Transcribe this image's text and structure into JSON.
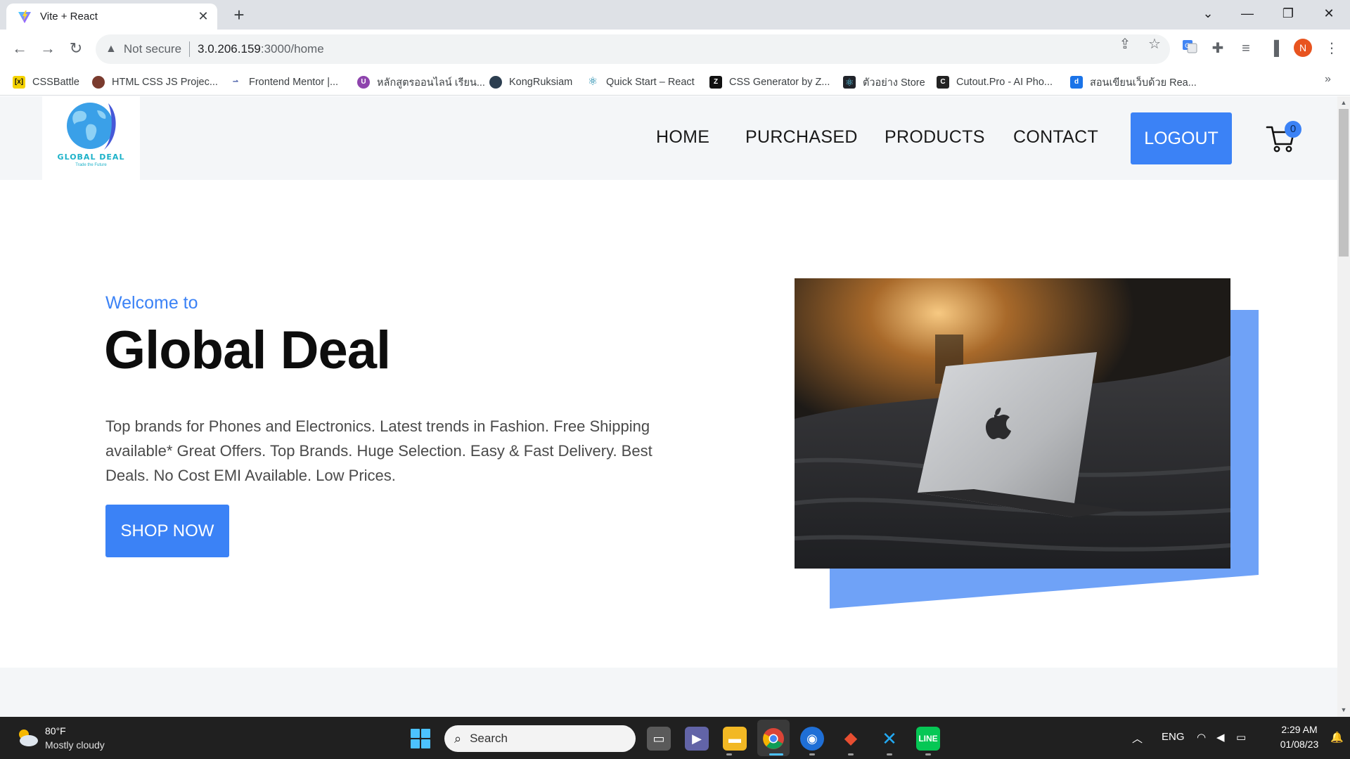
{
  "browser": {
    "tab_title": "Vite + React",
    "security_label": "Not secure",
    "url_host": "3.0.206.159",
    "url_path": ":3000/home",
    "profile_initial": "N"
  },
  "bookmarks": [
    {
      "label": "CSSBattle",
      "icon": "cssbattle-icon",
      "color": "#f5d300"
    },
    {
      "label": "HTML CSS JS Projec...",
      "icon": "avatar-icon",
      "color": "#7a3b2e"
    },
    {
      "label": "Frontend Mentor |...",
      "icon": "frontendmentor-icon",
      "color": "#3e54a3"
    },
    {
      "label": "หลักสูตรออนไลน์ เรียน...",
      "icon": "course-icon",
      "color": "#8e44ad"
    },
    {
      "label": "KongRuksiam",
      "icon": "kong-icon",
      "color": "#2c3e50"
    },
    {
      "label": "Quick Start – React",
      "icon": "react-icon",
      "color": "#087ea4"
    },
    {
      "label": "CSS Generator by Z...",
      "icon": "z-icon",
      "color": "#111111"
    },
    {
      "label": "ตัวอย่าง Store",
      "icon": "react-dark-icon",
      "color": "#20232a"
    },
    {
      "label": "Cutout.Pro - AI Pho...",
      "icon": "cutout-icon",
      "color": "#222222"
    },
    {
      "label": "สอนเขียนเว็บด้วย Rea...",
      "icon": "blog-icon",
      "color": "#1a73e8"
    }
  ],
  "site": {
    "logo_name": "GLOBAL DEAL",
    "logo_tagline": "Trade the Future",
    "nav": [
      "HOME",
      "PURCHASED",
      "PRODUCTS",
      "CONTACT"
    ],
    "logout_label": "LOGOUT",
    "cart_count": "0",
    "accent_color": "#3b82f6"
  },
  "hero": {
    "welcome": "Welcome to",
    "title": "Global Deal",
    "description": "Top brands for Phones and Electronics. Latest trends in Fashion. Free Shipping available* Great Offers. Top Brands. Huge Selection. Easy & Fast Delivery. Best Deals. No Cost EMI Available. Low Prices.",
    "cta": "SHOP NOW",
    "image": "laptop-on-bed-photo"
  },
  "taskbar": {
    "weather_temp": "80°F",
    "weather_desc": "Mostly cloudy",
    "search_label": "Search",
    "language": "ENG",
    "time": "2:29 AM",
    "date": "01/08/23",
    "apps": [
      "file-explorer-icon",
      "teams-icon",
      "folder-icon",
      "chrome-icon",
      "firefox-icon",
      "git-icon",
      "vscode-icon",
      "line-icon"
    ]
  }
}
